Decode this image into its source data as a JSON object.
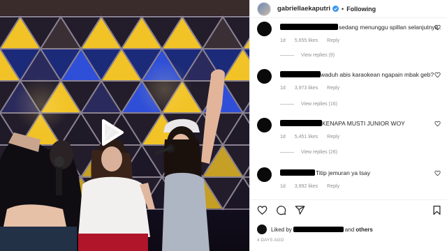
{
  "post": {
    "username": "gabriellaekaputri",
    "verified": true,
    "separator": "•",
    "follow_status": "Following",
    "time_ago": "4 DAYS AGO"
  },
  "media": {
    "type": "video",
    "play_icon": "play-icon"
  },
  "comments": [
    {
      "text": "sedang menunggu spillan selanjutnya..",
      "time": "1d",
      "likes": "5,655 likes",
      "reply": "Reply",
      "view_replies": "View replies (9)"
    },
    {
      "text": "waduh abis karaokean ngapain mbak geb?",
      "time": "1d",
      "likes": "3,973 likes",
      "reply": "Reply",
      "view_replies": "View replies (16)"
    },
    {
      "text": "KENAPA MUSTI JUNIOR WOY",
      "time": "1d",
      "likes": "5,451 likes",
      "reply": "Reply",
      "view_replies": "View replies (26)"
    },
    {
      "text": "Titip jemuran ya tsay",
      "time": "1d",
      "likes": "3,992 likes",
      "reply": "Reply"
    }
  ],
  "actions": {
    "icons": [
      "heart-icon",
      "comment-icon",
      "share-icon",
      "bookmark-icon"
    ]
  },
  "liked_by": {
    "prefix": "Liked by",
    "conjunction": "and",
    "others": "others"
  },
  "colors": {
    "text": "#262626",
    "secondary": "#8e8e8e",
    "verified": "#3897f0",
    "stage_yellow": "#f2c326",
    "stage_blue": "#2f4fd8"
  }
}
